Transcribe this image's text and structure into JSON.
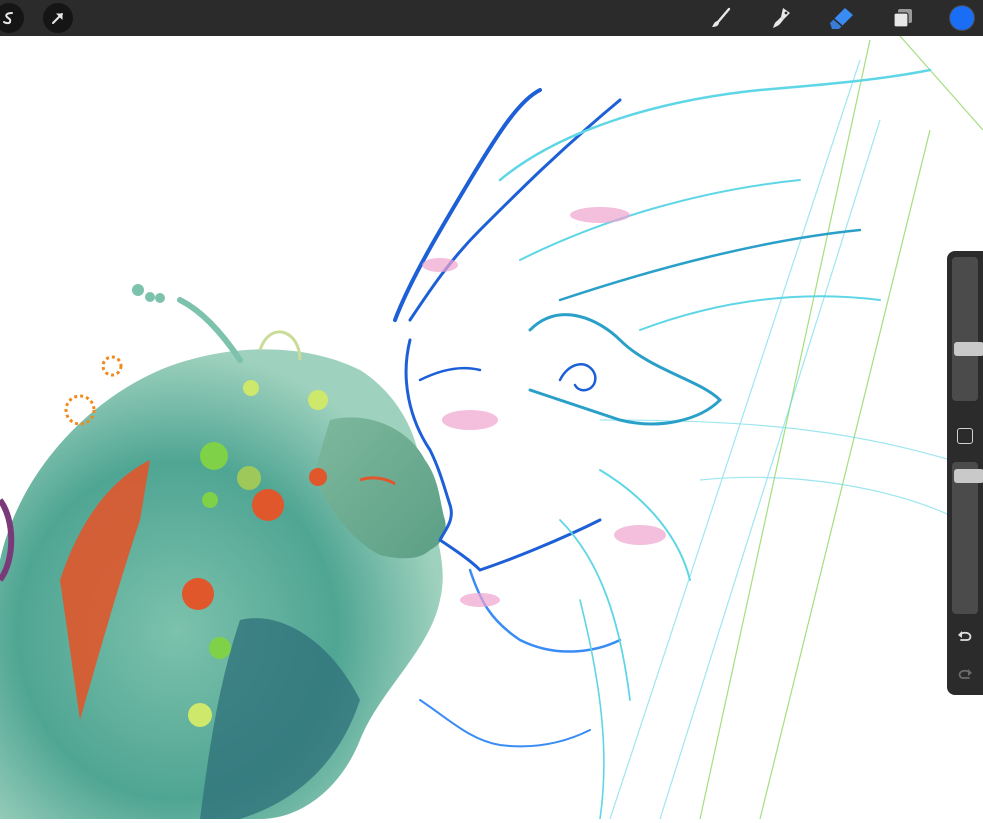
{
  "toolbar": {
    "left_tools": [
      {
        "name": "selection-icon"
      },
      {
        "name": "transform-arrow-icon"
      }
    ],
    "right_tools": [
      {
        "name": "brush-icon"
      },
      {
        "name": "smudge-icon"
      },
      {
        "name": "eraser-icon",
        "active": true
      },
      {
        "name": "layers-icon"
      }
    ],
    "active_color": "#1a6df5",
    "active_tool_color": "#3a8cf5"
  },
  "sidebar": {
    "brush_size_level": 0.35,
    "opacity_level": 0.95,
    "buttons": [
      {
        "name": "modify-square-icon"
      },
      {
        "name": "undo-icon"
      },
      {
        "name": "redo-icon"
      }
    ]
  },
  "canvas": {
    "palette": [
      "#6ab5a3",
      "#2e8f8c",
      "#e0572c",
      "#7fd148",
      "#1d5fd6",
      "#5ed6e6",
      "#f0a3cf",
      "#9ec95a"
    ]
  }
}
